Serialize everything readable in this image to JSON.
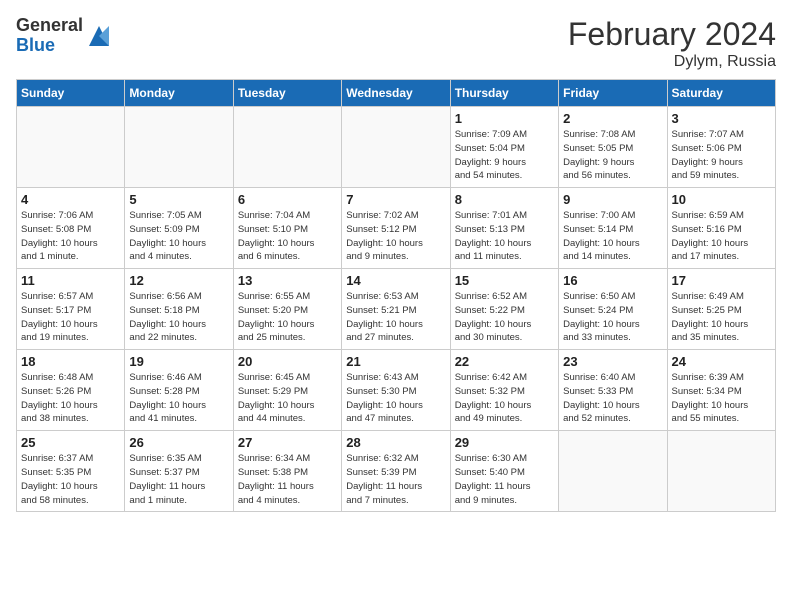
{
  "header": {
    "logo_general": "General",
    "logo_blue": "Blue",
    "month_year": "February 2024",
    "location": "Dylym, Russia"
  },
  "weekdays": [
    "Sunday",
    "Monday",
    "Tuesday",
    "Wednesday",
    "Thursday",
    "Friday",
    "Saturday"
  ],
  "weeks": [
    [
      {
        "day": "",
        "info": ""
      },
      {
        "day": "",
        "info": ""
      },
      {
        "day": "",
        "info": ""
      },
      {
        "day": "",
        "info": ""
      },
      {
        "day": "1",
        "info": "Sunrise: 7:09 AM\nSunset: 5:04 PM\nDaylight: 9 hours\nand 54 minutes."
      },
      {
        "day": "2",
        "info": "Sunrise: 7:08 AM\nSunset: 5:05 PM\nDaylight: 9 hours\nand 56 minutes."
      },
      {
        "day": "3",
        "info": "Sunrise: 7:07 AM\nSunset: 5:06 PM\nDaylight: 9 hours\nand 59 minutes."
      }
    ],
    [
      {
        "day": "4",
        "info": "Sunrise: 7:06 AM\nSunset: 5:08 PM\nDaylight: 10 hours\nand 1 minute."
      },
      {
        "day": "5",
        "info": "Sunrise: 7:05 AM\nSunset: 5:09 PM\nDaylight: 10 hours\nand 4 minutes."
      },
      {
        "day": "6",
        "info": "Sunrise: 7:04 AM\nSunset: 5:10 PM\nDaylight: 10 hours\nand 6 minutes."
      },
      {
        "day": "7",
        "info": "Sunrise: 7:02 AM\nSunset: 5:12 PM\nDaylight: 10 hours\nand 9 minutes."
      },
      {
        "day": "8",
        "info": "Sunrise: 7:01 AM\nSunset: 5:13 PM\nDaylight: 10 hours\nand 11 minutes."
      },
      {
        "day": "9",
        "info": "Sunrise: 7:00 AM\nSunset: 5:14 PM\nDaylight: 10 hours\nand 14 minutes."
      },
      {
        "day": "10",
        "info": "Sunrise: 6:59 AM\nSunset: 5:16 PM\nDaylight: 10 hours\nand 17 minutes."
      }
    ],
    [
      {
        "day": "11",
        "info": "Sunrise: 6:57 AM\nSunset: 5:17 PM\nDaylight: 10 hours\nand 19 minutes."
      },
      {
        "day": "12",
        "info": "Sunrise: 6:56 AM\nSunset: 5:18 PM\nDaylight: 10 hours\nand 22 minutes."
      },
      {
        "day": "13",
        "info": "Sunrise: 6:55 AM\nSunset: 5:20 PM\nDaylight: 10 hours\nand 25 minutes."
      },
      {
        "day": "14",
        "info": "Sunrise: 6:53 AM\nSunset: 5:21 PM\nDaylight: 10 hours\nand 27 minutes."
      },
      {
        "day": "15",
        "info": "Sunrise: 6:52 AM\nSunset: 5:22 PM\nDaylight: 10 hours\nand 30 minutes."
      },
      {
        "day": "16",
        "info": "Sunrise: 6:50 AM\nSunset: 5:24 PM\nDaylight: 10 hours\nand 33 minutes."
      },
      {
        "day": "17",
        "info": "Sunrise: 6:49 AM\nSunset: 5:25 PM\nDaylight: 10 hours\nand 35 minutes."
      }
    ],
    [
      {
        "day": "18",
        "info": "Sunrise: 6:48 AM\nSunset: 5:26 PM\nDaylight: 10 hours\nand 38 minutes."
      },
      {
        "day": "19",
        "info": "Sunrise: 6:46 AM\nSunset: 5:28 PM\nDaylight: 10 hours\nand 41 minutes."
      },
      {
        "day": "20",
        "info": "Sunrise: 6:45 AM\nSunset: 5:29 PM\nDaylight: 10 hours\nand 44 minutes."
      },
      {
        "day": "21",
        "info": "Sunrise: 6:43 AM\nSunset: 5:30 PM\nDaylight: 10 hours\nand 47 minutes."
      },
      {
        "day": "22",
        "info": "Sunrise: 6:42 AM\nSunset: 5:32 PM\nDaylight: 10 hours\nand 49 minutes."
      },
      {
        "day": "23",
        "info": "Sunrise: 6:40 AM\nSunset: 5:33 PM\nDaylight: 10 hours\nand 52 minutes."
      },
      {
        "day": "24",
        "info": "Sunrise: 6:39 AM\nSunset: 5:34 PM\nDaylight: 10 hours\nand 55 minutes."
      }
    ],
    [
      {
        "day": "25",
        "info": "Sunrise: 6:37 AM\nSunset: 5:35 PM\nDaylight: 10 hours\nand 58 minutes."
      },
      {
        "day": "26",
        "info": "Sunrise: 6:35 AM\nSunset: 5:37 PM\nDaylight: 11 hours\nand 1 minute."
      },
      {
        "day": "27",
        "info": "Sunrise: 6:34 AM\nSunset: 5:38 PM\nDaylight: 11 hours\nand 4 minutes."
      },
      {
        "day": "28",
        "info": "Sunrise: 6:32 AM\nSunset: 5:39 PM\nDaylight: 11 hours\nand 7 minutes."
      },
      {
        "day": "29",
        "info": "Sunrise: 6:30 AM\nSunset: 5:40 PM\nDaylight: 11 hours\nand 9 minutes."
      },
      {
        "day": "",
        "info": ""
      },
      {
        "day": "",
        "info": ""
      }
    ]
  ]
}
